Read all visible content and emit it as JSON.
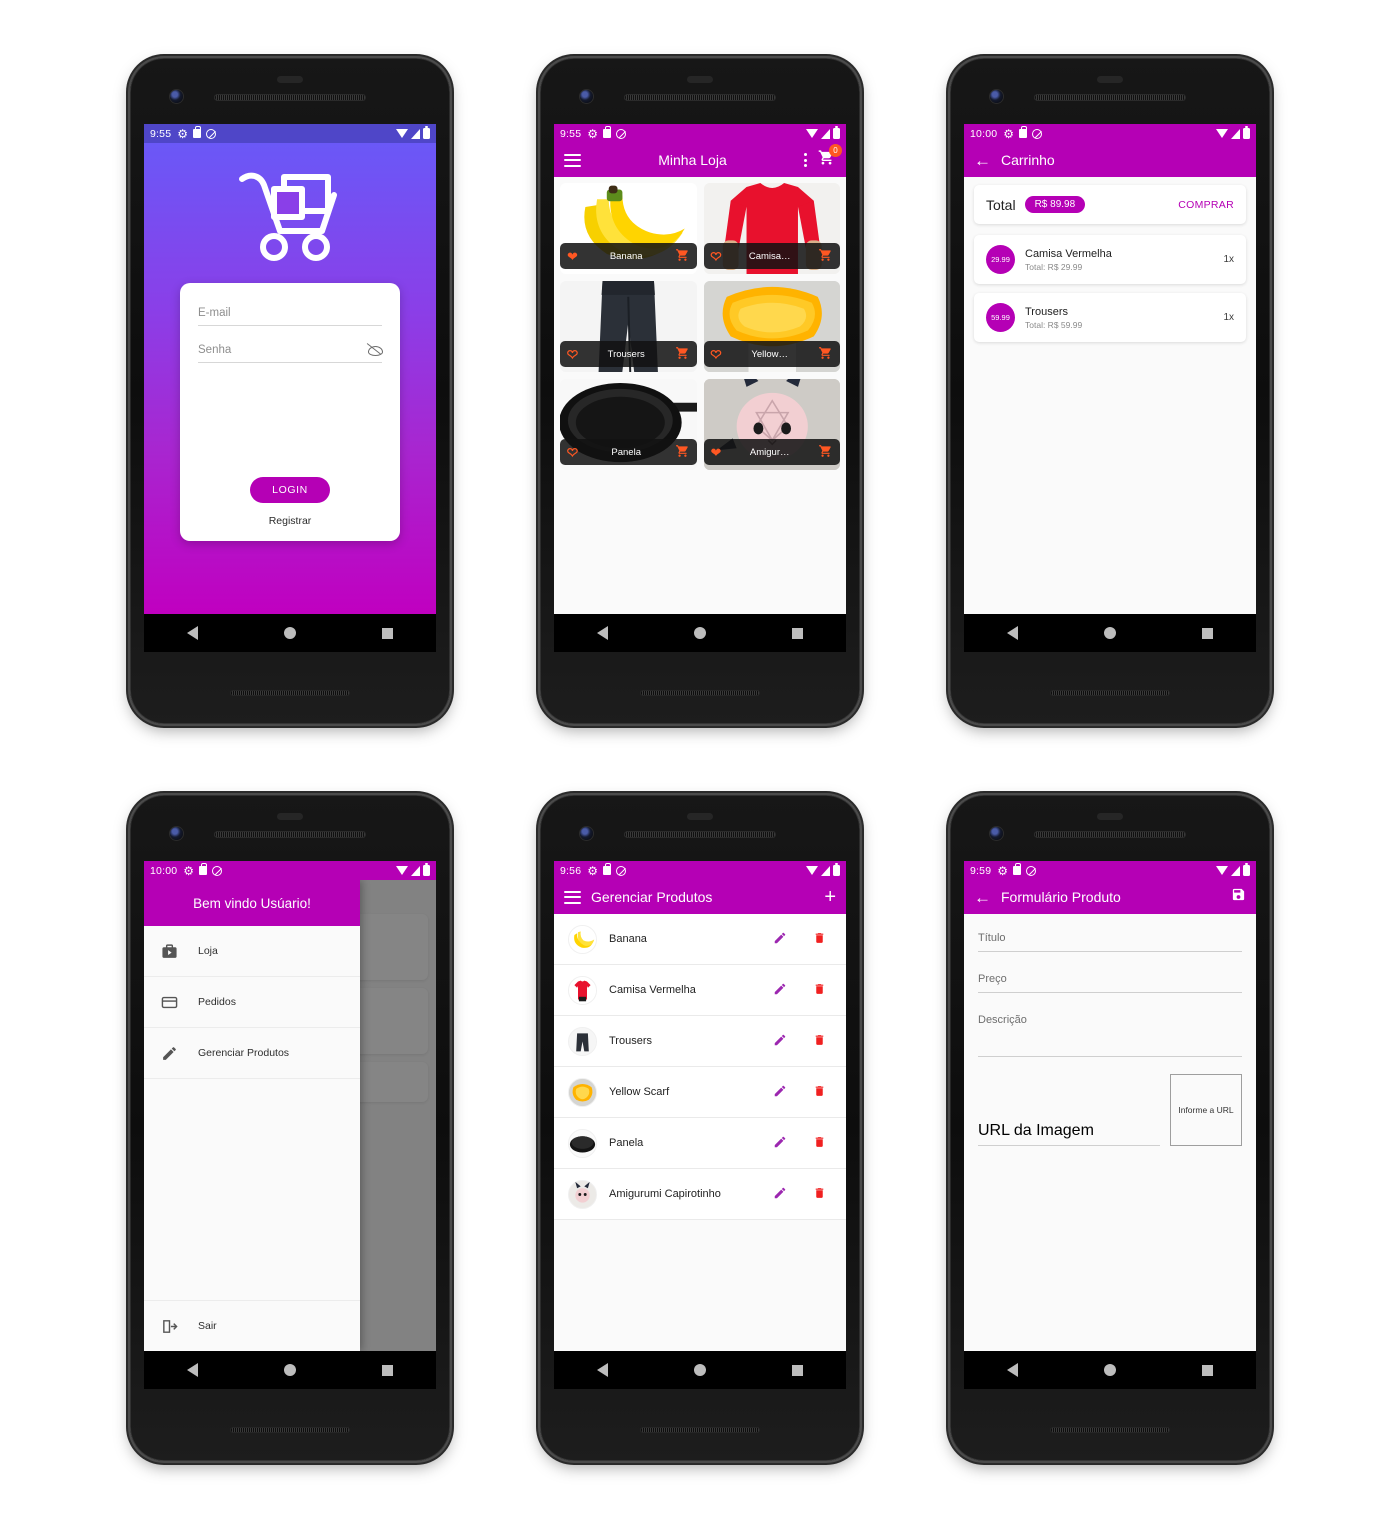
{
  "screens": {
    "login": {
      "status": {
        "time": "9:55",
        "icons": [
          "gear-icon",
          "lock-icon",
          "do-not-disturb-icon"
        ],
        "right": [
          "wifi-icon",
          "signal-icon",
          "battery-icon"
        ]
      },
      "logo": "shopping-cart-logo",
      "email_placeholder": "E-mail",
      "password_placeholder": "Senha",
      "login_button": "LOGIN",
      "register_link": "Registrar"
    },
    "store": {
      "status": {
        "time": "9:55"
      },
      "title": "Minha Loja",
      "cart_badge": "0",
      "products": [
        {
          "name": "Banana",
          "favorite": true,
          "image": "banana"
        },
        {
          "name": "Camisa…",
          "favorite": false,
          "image": "red-shirt"
        },
        {
          "name": "Trousers",
          "favorite": false,
          "image": "trousers"
        },
        {
          "name": "Yellow…",
          "favorite": false,
          "image": "yellow-scarf"
        },
        {
          "name": "Panela",
          "favorite": false,
          "image": "pan"
        },
        {
          "name": "Amigur…",
          "favorite": true,
          "image": "amigurumi"
        }
      ]
    },
    "cart": {
      "status": {
        "time": "10:00"
      },
      "title": "Carrinho",
      "total_label": "Total",
      "total_value": "R$ 89.98",
      "buy_button": "COMPRAR",
      "items": [
        {
          "price": "29.99",
          "title": "Camisa Vermelha",
          "subtitle": "Total: R$ 29.99",
          "qty": "1x"
        },
        {
          "price": "59.99",
          "title": "Trousers",
          "subtitle": "Total: R$ 59.99",
          "qty": "1x"
        }
      ]
    },
    "drawer": {
      "status": {
        "time": "10:00"
      },
      "header": "Bem vindo Usúario!",
      "items": [
        {
          "label": "Loja",
          "icon": "store-icon"
        },
        {
          "label": "Pedidos",
          "icon": "credit-card-icon"
        },
        {
          "label": "Gerenciar Produtos",
          "icon": "pencil-icon"
        }
      ],
      "logout": {
        "label": "Sair",
        "icon": "logout-icon"
      }
    },
    "manage": {
      "status": {
        "time": "9:56"
      },
      "title": "Gerenciar Produtos",
      "add_label": "+",
      "rows": [
        {
          "name": "Banana",
          "image": "banana"
        },
        {
          "name": "Camisa Vermelha",
          "image": "red-shirt"
        },
        {
          "name": "Trousers",
          "image": "trousers"
        },
        {
          "name": "Yellow Scarf",
          "image": "yellow-scarf"
        },
        {
          "name": "Panela",
          "image": "pan"
        },
        {
          "name": "Amigurumi Capirotinho",
          "image": "amigurumi"
        }
      ]
    },
    "form": {
      "status": {
        "time": "9:59"
      },
      "title": "Formulário Produto",
      "fields": {
        "title": "Título",
        "price": "Preço",
        "description": "Descrição",
        "image_url": "URL da Imagem"
      },
      "preview_text": "Informe a URL"
    }
  },
  "colors": {
    "primary": "#b500b5",
    "status_login": "#4f46c8",
    "accent_orange": "#ff5722",
    "delete_red": "#f02020",
    "edit_purple": "#9c27b0"
  }
}
